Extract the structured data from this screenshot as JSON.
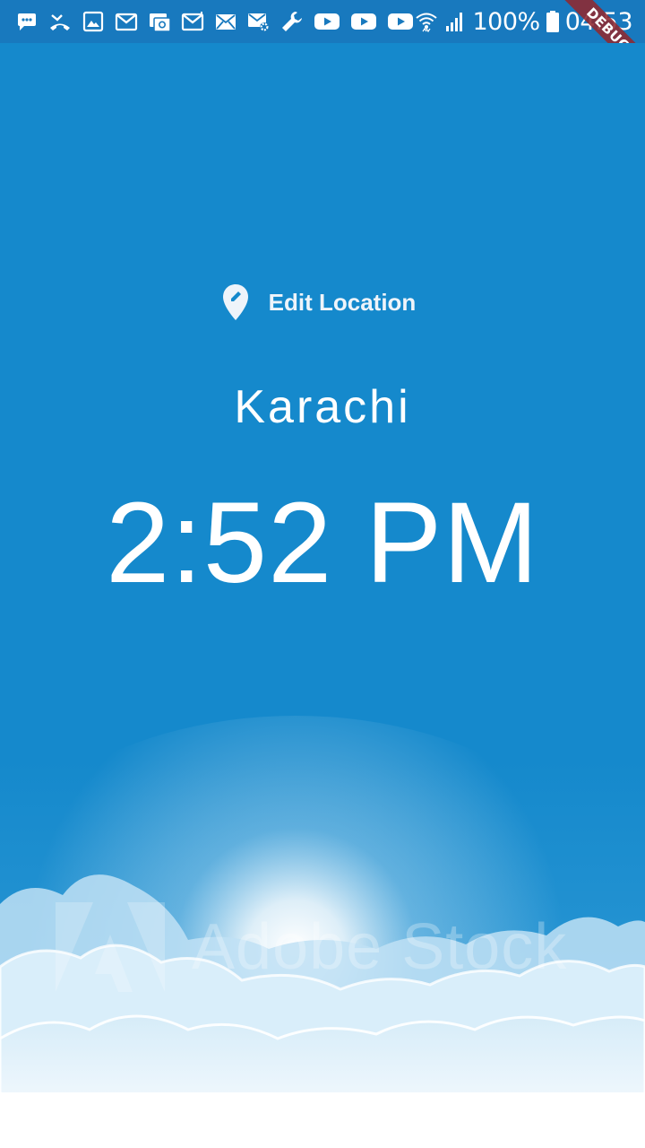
{
  "status_bar": {
    "battery": "100%",
    "time": "04:53",
    "left_icons": [
      "chat-icon",
      "missed-call-icon",
      "image-icon",
      "gmail-icon",
      "email-icon",
      "gmail-icon",
      "mail-icon",
      "mail-settings-icon",
      "wrench-icon",
      "youtube-icon",
      "youtube-icon",
      "youtube-icon"
    ],
    "right_icons": [
      "wifi-icon",
      "signal-icon",
      "battery-icon"
    ]
  },
  "debug_banner": "DEBUG",
  "main": {
    "edit_location_label": "Edit Location",
    "edit_location_icon": "edit-location-icon",
    "location": "Karachi",
    "time": "2:52 PM"
  },
  "background": {
    "watermark_text": "Adobe Stock",
    "sky_color": "#1589cc"
  }
}
